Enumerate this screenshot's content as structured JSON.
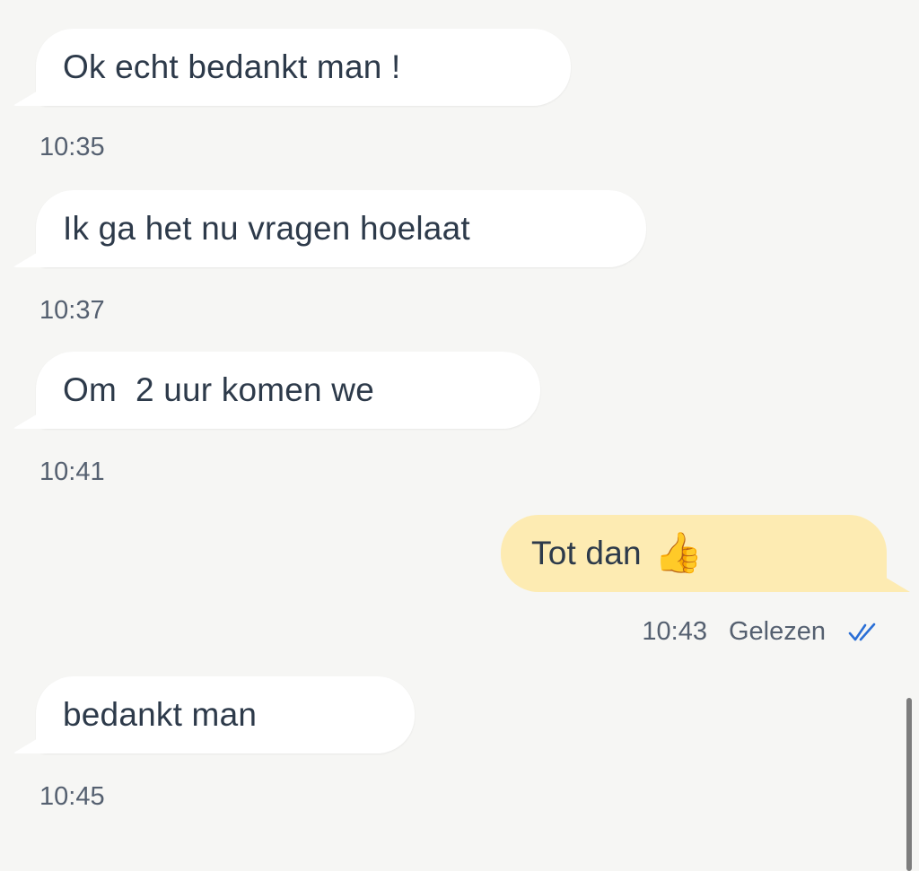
{
  "messages": [
    {
      "direction": "incoming",
      "text": "Ok echt bedankt man !",
      "time": "10:35"
    },
    {
      "direction": "incoming",
      "text": "Ik ga het nu vragen hoelaat",
      "time": "10:37"
    },
    {
      "direction": "incoming",
      "text": "Om  2 uur komen we",
      "time": "10:41"
    },
    {
      "direction": "outgoing",
      "text": "Tot dan",
      "emoji": "👍",
      "time": "10:43",
      "status": "Gelezen",
      "status_icon": "double-check-icon"
    },
    {
      "direction": "incoming",
      "text": "bedankt man",
      "time": "10:45"
    }
  ],
  "colors": {
    "background": "#f6f6f4",
    "incoming_bubble": "#ffffff",
    "outgoing_bubble": "#fdebb2",
    "text": "#2d3a4a",
    "meta_text": "#556070",
    "read_check": "#2a6fd6"
  }
}
